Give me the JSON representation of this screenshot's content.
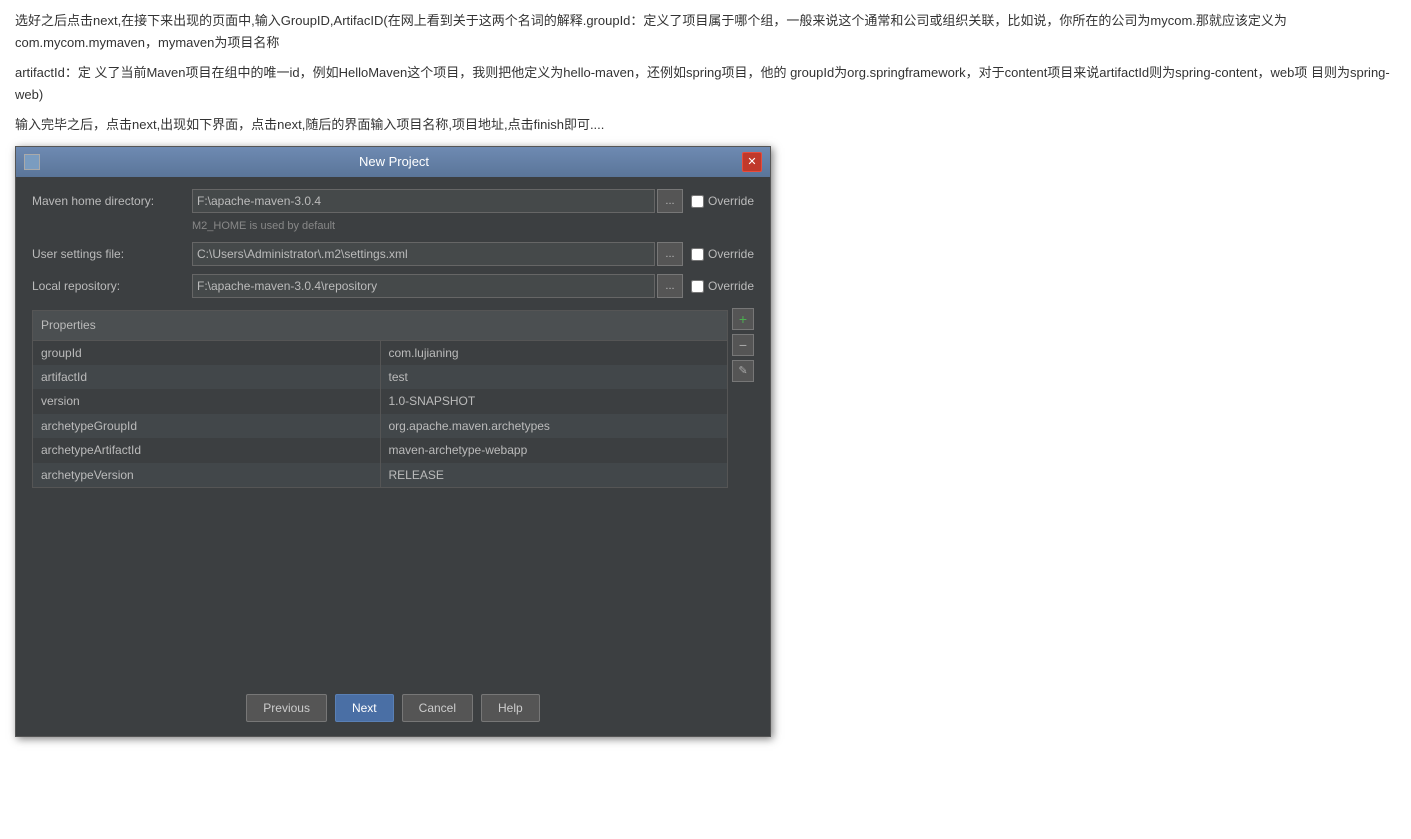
{
  "page": {
    "text_line1": "选好之后点击next,在接下来出现的页面中,输入GroupID,ArtifacID(在网上看到关于这两个名词的解释.groupId：定义了项目属于哪个组，一般来说这个通常和公司或组织关联，比如说，你所在的公司为mycom.那就应该定义为com.mycom.mymaven，mymaven为项目名称",
    "text_line2": "artifactId：定 义了当前Maven项目在组中的唯一id，例如HelloMaven这个项目，我则把他定义为hello-maven，还例如spring项目，他的 groupId为org.springframework，对于content项目来说artifactId则为spring-content，web项 目则为spring-web)",
    "text_line3": "输入完毕之后，点击next,出现如下界面，点击next,随后的界面输入项目名称,项目地址,点击finish即可...."
  },
  "dialog": {
    "title": "New Project",
    "close_btn": "✕",
    "maven_home": {
      "label": "Maven home directory:",
      "value": "F:\\apache-maven-3.0.4",
      "browse_btn": "...",
      "checkbox_label": "Override",
      "hint": "M2_HOME is used by default"
    },
    "user_settings": {
      "label": "User settings file:",
      "value": "C:\\Users\\Administrator\\.m2\\settings.xml",
      "browse_btn": "...",
      "checkbox_label": "Override"
    },
    "local_repo": {
      "label": "Local repository:",
      "value": "F:\\apache-maven-3.0.4\\repository",
      "browse_btn": "...",
      "checkbox_label": "Override"
    },
    "properties": {
      "header": "Properties",
      "rows": [
        {
          "key": "groupId",
          "value": "com.lujianing"
        },
        {
          "key": "artifactId",
          "value": "test"
        },
        {
          "key": "version",
          "value": "1.0-SNAPSHOT"
        },
        {
          "key": "archetypeGroupId",
          "value": "org.apache.maven.archetypes"
        },
        {
          "key": "archetypeArtifactId",
          "value": "maven-archetype-webapp"
        },
        {
          "key": "archetypeVersion",
          "value": "RELEASE"
        }
      ],
      "add_btn": "+",
      "remove_btn": "−",
      "edit_btn": "✎"
    },
    "buttons": {
      "previous": "Previous",
      "next": "Next",
      "cancel": "Cancel",
      "help": "Help"
    }
  }
}
